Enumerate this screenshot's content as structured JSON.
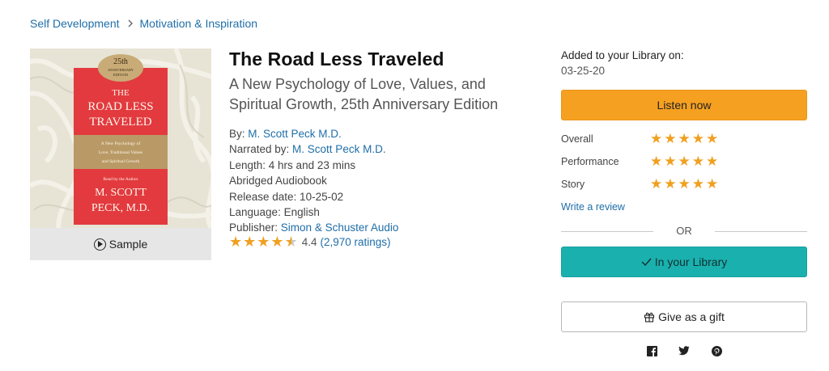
{
  "breadcrumb": {
    "items": [
      "Self Development",
      "Motivation & Inspiration"
    ],
    "separator_icon": "chevron-right-icon"
  },
  "cover": {
    "top_badge_lines": [
      "25th",
      "ANNIVERSARY",
      "EDITION"
    ],
    "title_lines": [
      "THE",
      "ROAD LESS",
      "TRAVELED"
    ],
    "tagline_lines": [
      "A New Psychology of",
      "Love, Traditional Values",
      "and Spiritual Growth"
    ],
    "read_by": "Read by the Author",
    "author_lines": [
      "M. SCOTT",
      "PECK, M.D."
    ],
    "sample_label": "Sample",
    "colors": {
      "red": "#e23a3f",
      "tan": "#b99a66",
      "bg": "#e7e4d6"
    }
  },
  "book": {
    "title": "The Road Less Traveled",
    "subtitle": "A New Psychology of Love, Values, and Spiritual Growth, 25th Anniversary Edition",
    "by_label": "By: ",
    "author": "M. Scott Peck M.D.",
    "narrated_label": "Narrated by: ",
    "narrator": "M. Scott Peck M.D.",
    "length": "Length: 4 hrs and 23 mins",
    "format": "Abridged Audiobook",
    "release_date": "Release date: 10-25-02",
    "language": "Language: English",
    "publisher_label": "Publisher: ",
    "publisher": "Simon & Schuster Audio",
    "rating_value": "4.4",
    "rating_count": "(2,970 ratings)",
    "rating_stars": 4.5
  },
  "library": {
    "added_label": "Added to your Library on:",
    "added_date": "03-25-20",
    "listen_label": "Listen now",
    "ratings": [
      {
        "label": "Overall",
        "stars": 5
      },
      {
        "label": "Performance",
        "stars": 5
      },
      {
        "label": "Story",
        "stars": 5
      }
    ],
    "write_review": "Write a review",
    "or_text": "OR",
    "in_library_label": "In your Library",
    "gift_label": "Give as a gift"
  },
  "social": [
    "facebook-icon",
    "twitter-icon",
    "pinterest-icon"
  ],
  "colors": {
    "accent": "#f6a021",
    "teal": "#1ab0ae",
    "link": "#1f6ea8",
    "star": "#f0a020"
  }
}
